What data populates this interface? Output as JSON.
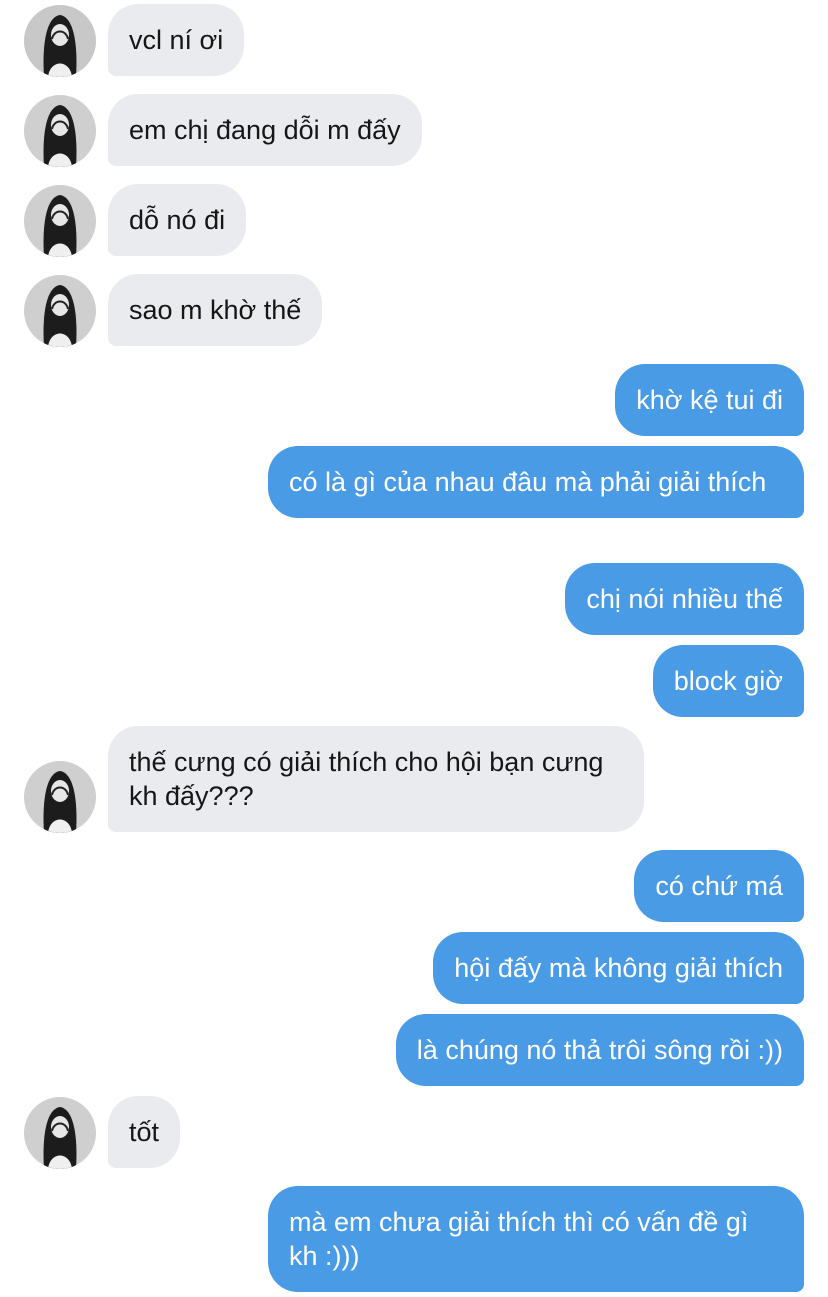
{
  "colors": {
    "incoming_bubble": "#e9ebef",
    "outgoing_bubble": "#4a9be6",
    "incoming_text": "#161616",
    "outgoing_text": "#ffffff"
  },
  "contact": {
    "avatar_icon": "user-avatar-photo"
  },
  "messages": [
    {
      "from": "them",
      "text": "vcl ní ơi"
    },
    {
      "from": "them",
      "text": "em chị đang dỗi m đấy"
    },
    {
      "from": "them",
      "text": "dỗ nó đi"
    },
    {
      "from": "them",
      "text": "sao m khờ thế"
    },
    {
      "from": "me",
      "text": "khờ kệ tui đi"
    },
    {
      "from": "me",
      "text": "có là gì của nhau đâu mà phải giải thích"
    },
    {
      "from": "me",
      "text": "chị nói nhiều thế"
    },
    {
      "from": "me",
      "text": "block giờ"
    },
    {
      "from": "them",
      "text": "thế cưng có giải thích cho hội bạn cưng kh đấy???"
    },
    {
      "from": "me",
      "text": "có chứ má"
    },
    {
      "from": "me",
      "text": "hội đấy mà không giải thích"
    },
    {
      "from": "me",
      "text": "là chúng nó thả trôi sông rồi :))"
    },
    {
      "from": "them",
      "text": "tốt"
    },
    {
      "from": "me",
      "text": "mà em chưa giải thích thì có vấn đề gì kh :)))"
    }
  ]
}
